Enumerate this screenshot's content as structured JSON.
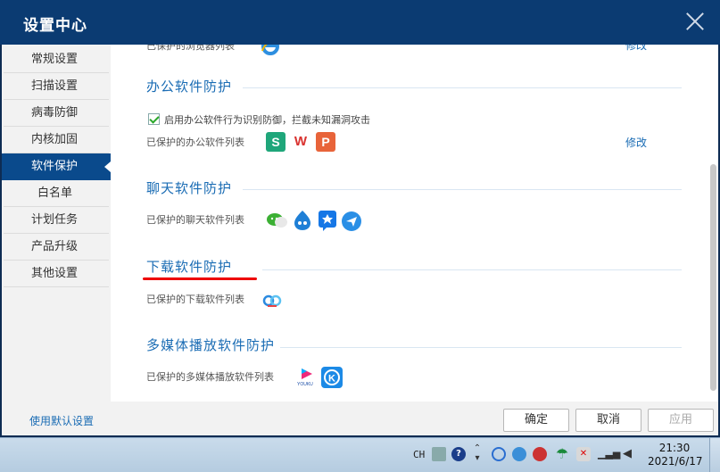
{
  "window": {
    "title": "设置中心",
    "close_icon": "close-icon"
  },
  "sidebar": {
    "items": [
      {
        "label": "常规设置",
        "active": false,
        "sub": false
      },
      {
        "label": "扫描设置",
        "active": false,
        "sub": false
      },
      {
        "label": "病毒防御",
        "active": false,
        "sub": false
      },
      {
        "label": "内核加固",
        "active": false,
        "sub": false
      },
      {
        "label": "软件保护",
        "active": true,
        "sub": false
      },
      {
        "label": "白名单",
        "active": false,
        "sub": true
      },
      {
        "label": "计划任务",
        "active": false,
        "sub": false
      },
      {
        "label": "产品升级",
        "active": false,
        "sub": false
      },
      {
        "label": "其他设置",
        "active": false,
        "sub": false
      }
    ]
  },
  "content": {
    "browser": {
      "label": "已保护的浏览器列表",
      "modify": "修改"
    },
    "office": {
      "title": "办公软件防护",
      "checkbox_label": "启用办公软件行为识别防御，拦截未知漏洞攻击",
      "list_label": "已保护的办公软件列表",
      "modify": "修改",
      "icons": [
        {
          "name": "wps-spreadsheet-icon",
          "glyph": "S",
          "color": "#1fa67a"
        },
        {
          "name": "wps-writer-icon",
          "glyph": "W",
          "color": "#d9322f"
        },
        {
          "name": "wps-presentation-icon",
          "glyph": "P",
          "color": "#e8643a"
        }
      ]
    },
    "chat": {
      "title": "聊天软件防护",
      "list_label": "已保护的聊天软件列表"
    },
    "download": {
      "title": "下载软件防护",
      "list_label": "已保护的下载软件列表"
    },
    "media": {
      "title": "多媒体播放软件防护",
      "list_label": "已保护的多媒体播放软件列表",
      "youku_text": "YOUKU"
    }
  },
  "footer": {
    "default_link": "使用默认设置",
    "ok": "确定",
    "cancel": "取消",
    "apply": "应用"
  },
  "taskbar": {
    "lang": "CH",
    "time": "21:30",
    "date": "2021/6/17"
  }
}
